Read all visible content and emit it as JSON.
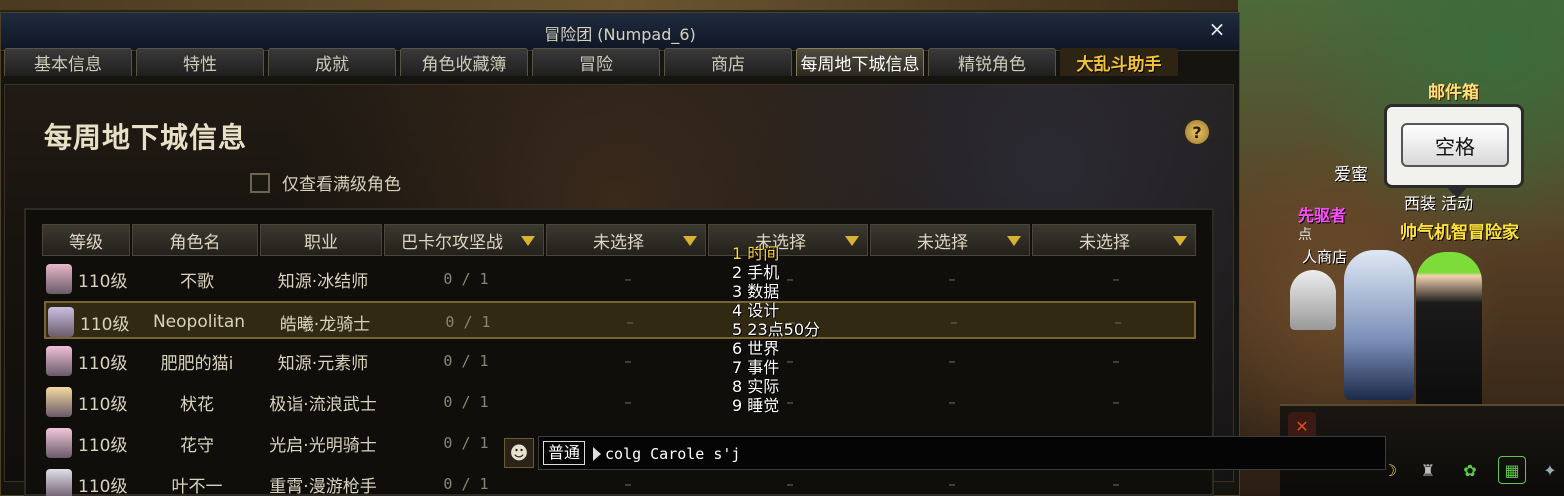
{
  "window": {
    "title": "冒险团 (Numpad_6)",
    "close_label": "×"
  },
  "tabs": [
    {
      "label": "基本信息"
    },
    {
      "label": "特性"
    },
    {
      "label": "成就"
    },
    {
      "label": "角色收藏簿"
    },
    {
      "label": "冒险"
    },
    {
      "label": "商店"
    },
    {
      "label": "每周地下城信息",
      "active": true
    },
    {
      "label": "精锐角色"
    }
  ],
  "helper_label": "大乱斗助手",
  "page": {
    "title": "每周地下城信息",
    "help_icon": "?",
    "filter_checkbox_label": "仅查看满级角色",
    "filter_checked": false
  },
  "table": {
    "columns": [
      "等级",
      "角色名",
      "职业",
      "巴卡尔攻坚战",
      "未选择",
      "未选择",
      "未选择",
      "未选择"
    ],
    "rows": [
      {
        "level": "110级",
        "name": "不歌",
        "job": "知源·冰结师",
        "progress": "0 / 1",
        "avatar_color": "#e8b8c8"
      },
      {
        "level": "110级",
        "name": "Neopolitan",
        "job": "皓曦·龙骑士",
        "progress": "0 / 1",
        "avatar_color": "#c9c0e0",
        "selected": true
      },
      {
        "level": "110级",
        "name": "肥肥的猫i",
        "job": "知源·元素师",
        "progress": "0 / 1",
        "avatar_color": "#f0c0d8"
      },
      {
        "level": "110级",
        "name": "枤花",
        "job": "极诣·流浪武士",
        "progress": "0 / 1",
        "avatar_color": "#f3dba0"
      },
      {
        "level": "110级",
        "name": "花守",
        "job": "光启·光明骑士",
        "progress": "0 / 1",
        "avatar_color": "#f0c8d8"
      },
      {
        "level": "110级",
        "name": "叶不一",
        "job": "重霄·漫游枪手",
        "progress": "0 / 1",
        "avatar_color": "#e0e0e8"
      }
    ],
    "empty_mark": "–"
  },
  "dropdown": {
    "items": [
      {
        "num": "1",
        "text": "时间"
      },
      {
        "num": "2",
        "text": "手机"
      },
      {
        "num": "3",
        "text": "数据"
      },
      {
        "num": "4",
        "text": "设计"
      },
      {
        "num": "5",
        "text": "23点50分"
      },
      {
        "num": "6",
        "text": "世界"
      },
      {
        "num": "7",
        "text": "事件"
      },
      {
        "num": "8",
        "text": "实际"
      },
      {
        "num": "9",
        "text": "睡觉"
      }
    ]
  },
  "chat": {
    "channel": "普通",
    "input_value": "colg Carole s'j",
    "emoji_icon": "smiley-face-icon"
  },
  "scene": {
    "mailbox_label": "邮件箱",
    "space_key_label": "空格",
    "npc_love": "爱蜜",
    "guild_tag": "先驱者",
    "player_name": "帅气机智冒险家",
    "mini_text": "西装  活动",
    "pt_text": "点",
    "ren_text": "人商店"
  },
  "colors": {
    "accent_gold": "#d9b233",
    "highlight_row": "#7a6434",
    "player_name": "#ffe23a",
    "guild_tag": "#ff4dff"
  }
}
